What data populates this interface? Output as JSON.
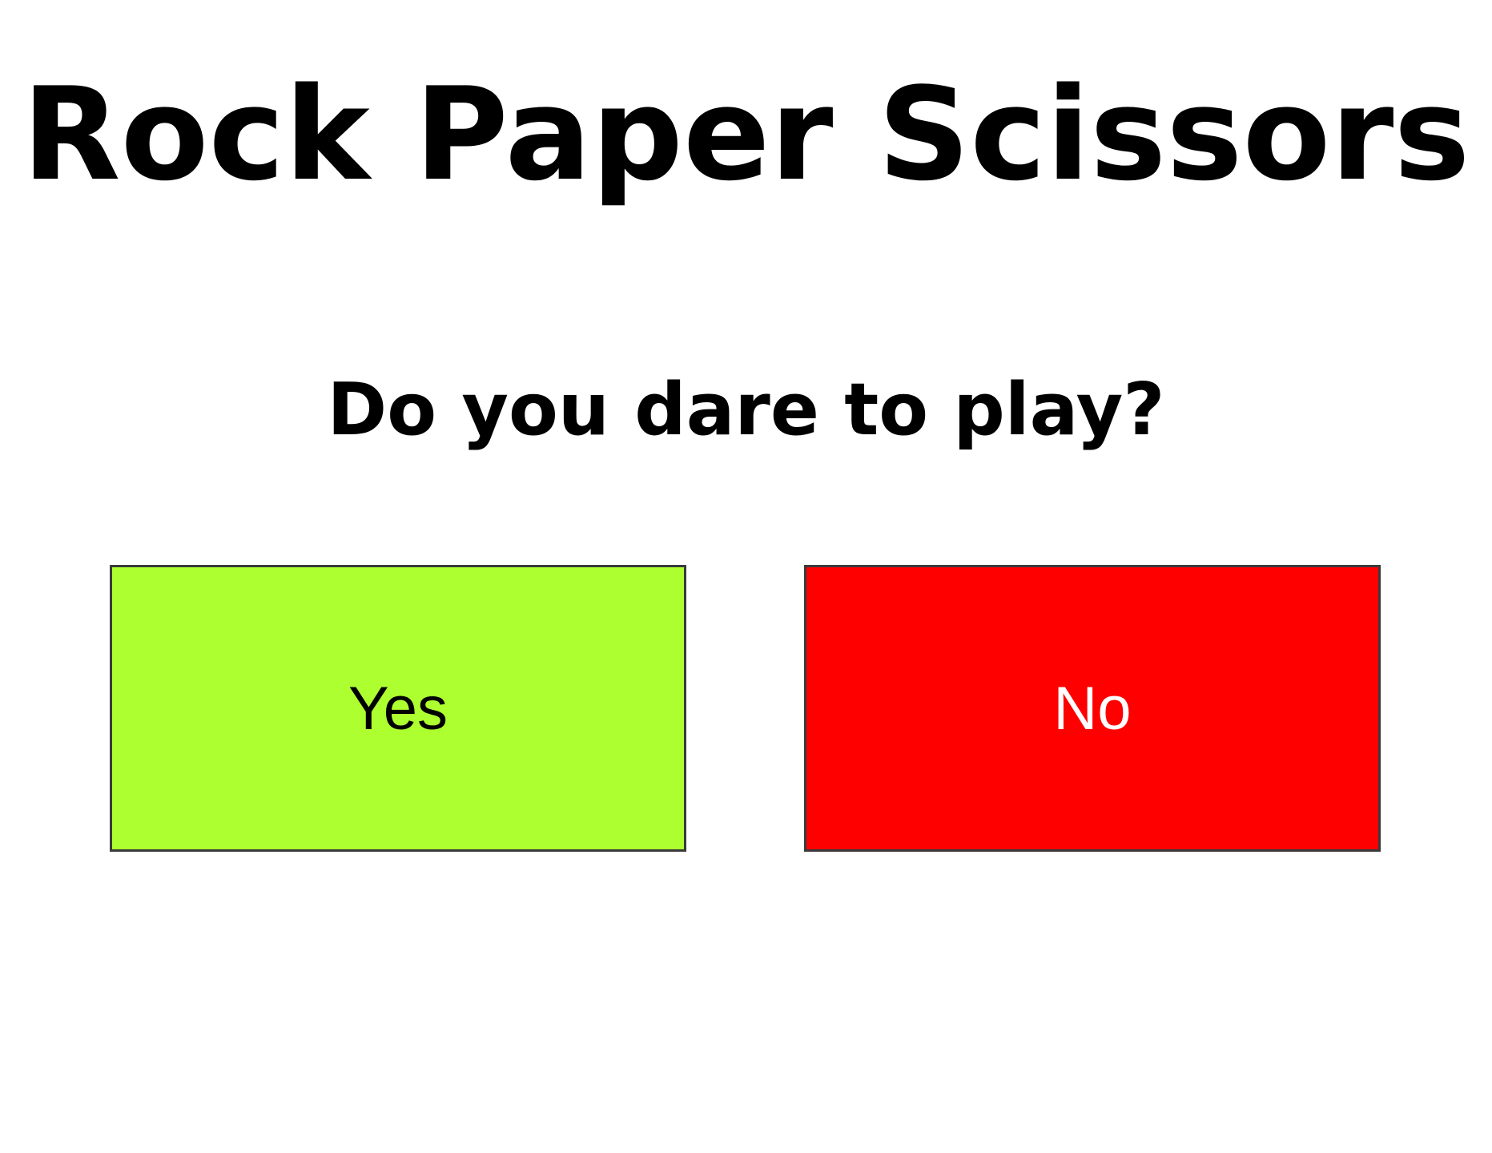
{
  "header": {
    "title": "Rock Paper Scissors"
  },
  "prompt": {
    "question": "Do you dare to play?"
  },
  "choices": {
    "yes_label": "Yes",
    "no_label": "No"
  },
  "colors": {
    "yes_background": "#adff2f",
    "no_background": "#ff0000",
    "yes_text": "#000000",
    "no_text": "#ffffff"
  }
}
